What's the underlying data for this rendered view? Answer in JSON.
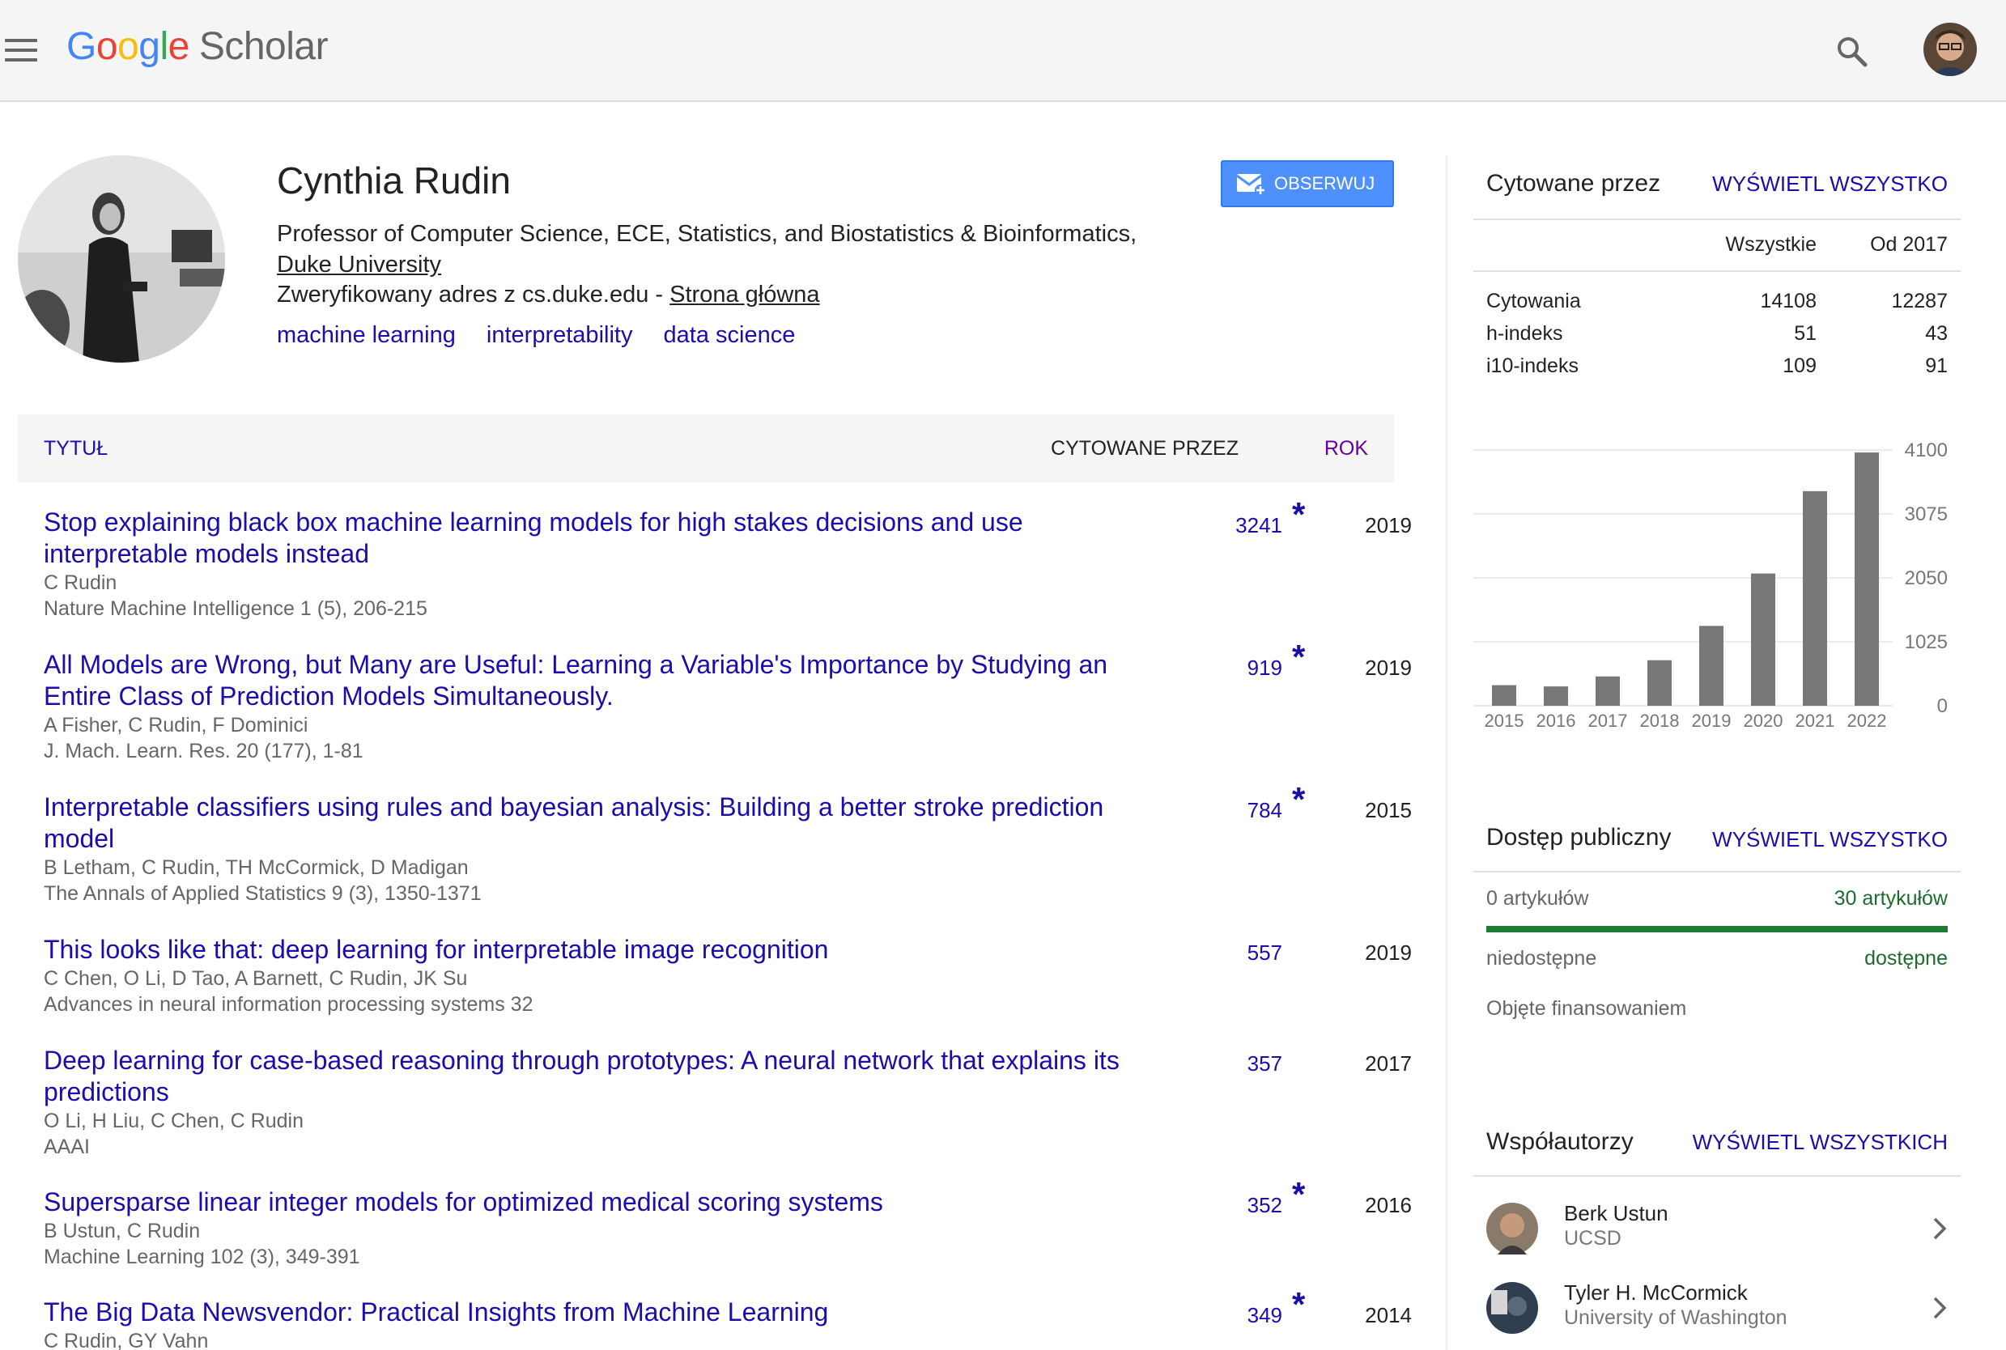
{
  "header": {
    "logo_google": "Google",
    "logo_scholar": "Scholar"
  },
  "profile": {
    "name": "Cynthia Rudin",
    "affiliation_text": "Professor of Computer Science, ECE, Statistics, and Biostatistics & Bioinformatics,",
    "affiliation_link": "Duke University",
    "email_text": "Zweryfikowany adres z cs.duke.edu -",
    "homepage_link": "Strona główna",
    "interests": [
      "machine learning",
      "interpretability",
      "data science"
    ],
    "follow_label": "OBSERWUJ"
  },
  "table": {
    "col_title": "TYTUŁ",
    "col_cited": "CYTOWANE PRZEZ",
    "col_year": "ROK"
  },
  "articles": [
    {
      "title": "Stop explaining black box machine learning models for high stakes decisions and use interpretable models instead",
      "authors": "C Rudin",
      "venue": "Nature Machine Intelligence 1 (5), 206-215",
      "cites": "3241",
      "star": "*",
      "year": "2019"
    },
    {
      "title": "All Models are Wrong, but Many are Useful: Learning a Variable's Importance by Studying an Entire Class of Prediction Models Simultaneously.",
      "authors": "A Fisher, C Rudin, F Dominici",
      "venue": "J. Mach. Learn. Res. 20 (177), 1-81",
      "cites": "919",
      "star": "*",
      "year": "2019"
    },
    {
      "title": "Interpretable classifiers using rules and bayesian analysis: Building a better stroke prediction model",
      "authors": "B Letham, C Rudin, TH McCormick, D Madigan",
      "venue": "The Annals of Applied Statistics 9 (3), 1350-1371",
      "cites": "784",
      "star": "*",
      "year": "2015"
    },
    {
      "title": "This looks like that: deep learning for interpretable image recognition",
      "authors": "C Chen, O Li, D Tao, A Barnett, C Rudin, JK Su",
      "venue": "Advances in neural information processing systems 32",
      "cites": "557",
      "star": "",
      "year": "2019"
    },
    {
      "title": "Deep learning for case-based reasoning through prototypes: A neural network that explains its predictions",
      "authors": "O Li, H Liu, C Chen, C Rudin",
      "venue": "AAAI",
      "cites": "357",
      "star": "",
      "year": "2017"
    },
    {
      "title": "Supersparse linear integer models for optimized medical scoring systems",
      "authors": "B Ustun, C Rudin",
      "venue": "Machine Learning 102 (3), 349-391",
      "cites": "352",
      "star": "*",
      "year": "2016"
    },
    {
      "title": "The Big Data Newsvendor: Practical Insights from Machine Learning",
      "authors": "C Rudin, GY Vahn",
      "venue": "",
      "cites": "349",
      "star": "*",
      "year": "2014"
    }
  ],
  "cited_by": {
    "title": "Cytowane przez",
    "view_all": "WYŚWIETL WSZYSTKO",
    "col_all": "Wszystkie",
    "col_since": "Od 2017",
    "rows": [
      {
        "label": "Cytowania",
        "all": "14108",
        "since": "12287"
      },
      {
        "label": "h-indeks",
        "all": "51",
        "since": "43"
      },
      {
        "label": "i10-indeks",
        "all": "109",
        "since": "91"
      }
    ]
  },
  "chart_data": {
    "type": "bar",
    "categories": [
      "2015",
      "2016",
      "2017",
      "2018",
      "2019",
      "2020",
      "2021",
      "2022"
    ],
    "values": [
      330,
      310,
      470,
      730,
      1280,
      2120,
      3440,
      4060
    ],
    "yticks": [
      "0",
      "1025",
      "2050",
      "3075",
      "4100"
    ],
    "ylim": [
      0,
      4100
    ],
    "bar_color": "#777777"
  },
  "public_access": {
    "title": "Dostęp publiczny",
    "view_all": "WYŚWIETL WSZYSTKO",
    "unavailable_count": "0 artykułów",
    "available_count": "30 artykułów",
    "unavailable_label": "niedostępne",
    "available_label": "dostępne",
    "funding_label": "Objęte finansowaniem",
    "available_fraction": 1.0
  },
  "coauthors": {
    "title": "Współautorzy",
    "view_all": "WYŚWIETL WSZYSTKICH",
    "items": [
      {
        "name": "Berk Ustun",
        "affiliation": "UCSD"
      },
      {
        "name": "Tyler H. McCormick",
        "affiliation": "University of Washington"
      }
    ]
  }
}
